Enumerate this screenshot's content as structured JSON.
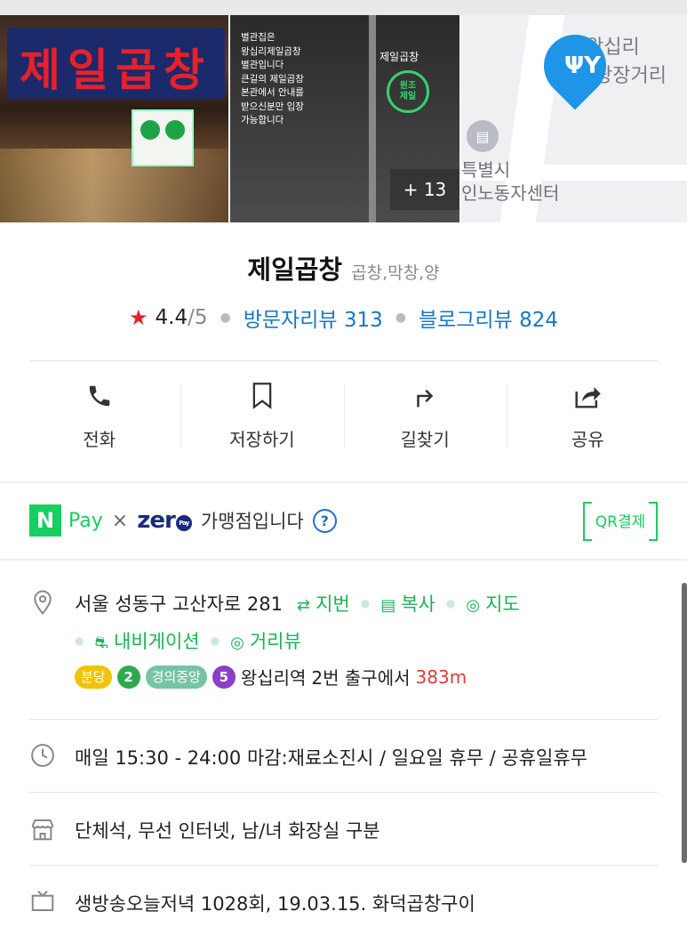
{
  "photos": {
    "sign_text": "제일곱창",
    "sign_text_blue": "곱창",
    "door_notice": "별관집은\n왕십리제일곱창\n별관입니다\n큰길의 제일곱창\n본관에서 안내를\n받으신분만 입장\n가능합니다",
    "door_logo": "제일곱창",
    "door_circle": "원조\n제일",
    "more_count": "+ 13",
    "map_labels": [
      "왕십리",
      "광장거리",
      "특별시",
      "인노동자센터"
    ]
  },
  "place": {
    "name": "제일곱창",
    "category": "곱창,막창,양",
    "rating": "4.4",
    "rating_max": "/5",
    "visitor_reviews": "방문자리뷰 313",
    "blog_reviews": "블로그리뷰 824"
  },
  "actions": [
    {
      "label": "전화",
      "icon": "phone-icon"
    },
    {
      "label": "저장하기",
      "icon": "bookmark-icon"
    },
    {
      "label": "길찾기",
      "icon": "directions-icon"
    },
    {
      "label": "공유",
      "icon": "share-icon"
    }
  ],
  "pay": {
    "n": "N",
    "pay_word": "Pay",
    "times": "×",
    "zero": "zer",
    "zero_pay": "Pay",
    "member_text": "가맹점입니다",
    "help": "?",
    "qr": "QR결제"
  },
  "address": {
    "text": "서울 성동구 고산자로 281",
    "jibun": "지번",
    "copy": "복사",
    "map": "지도",
    "navigation": "내비게이션",
    "street_view": "거리뷰",
    "lines": [
      {
        "name": "분당",
        "color": "#f2c300"
      },
      {
        "name": "2",
        "color": "#2fa94e"
      },
      {
        "name": "경의중앙",
        "color": "#77c4a3"
      },
      {
        "name": "5",
        "color": "#8b3fc8"
      }
    ],
    "station": "왕십리역",
    "exit_text": "2번 출구에서",
    "distance": "383m"
  },
  "hours": "매일 15:30 - 24:00 마감:재료소진시 / 일요일 휴무 / 공휴일휴무",
  "facilities": "단체석, 무선 인터넷, 남/녀 화장실 구분",
  "tv": "생방송오늘저녁 1028회, 19.03.15. 화덕곱창구이",
  "colors": {
    "green": "#19ce60",
    "blue_link": "#1877c9",
    "star": "#e8202a",
    "map_pin": "#1f95e8"
  }
}
